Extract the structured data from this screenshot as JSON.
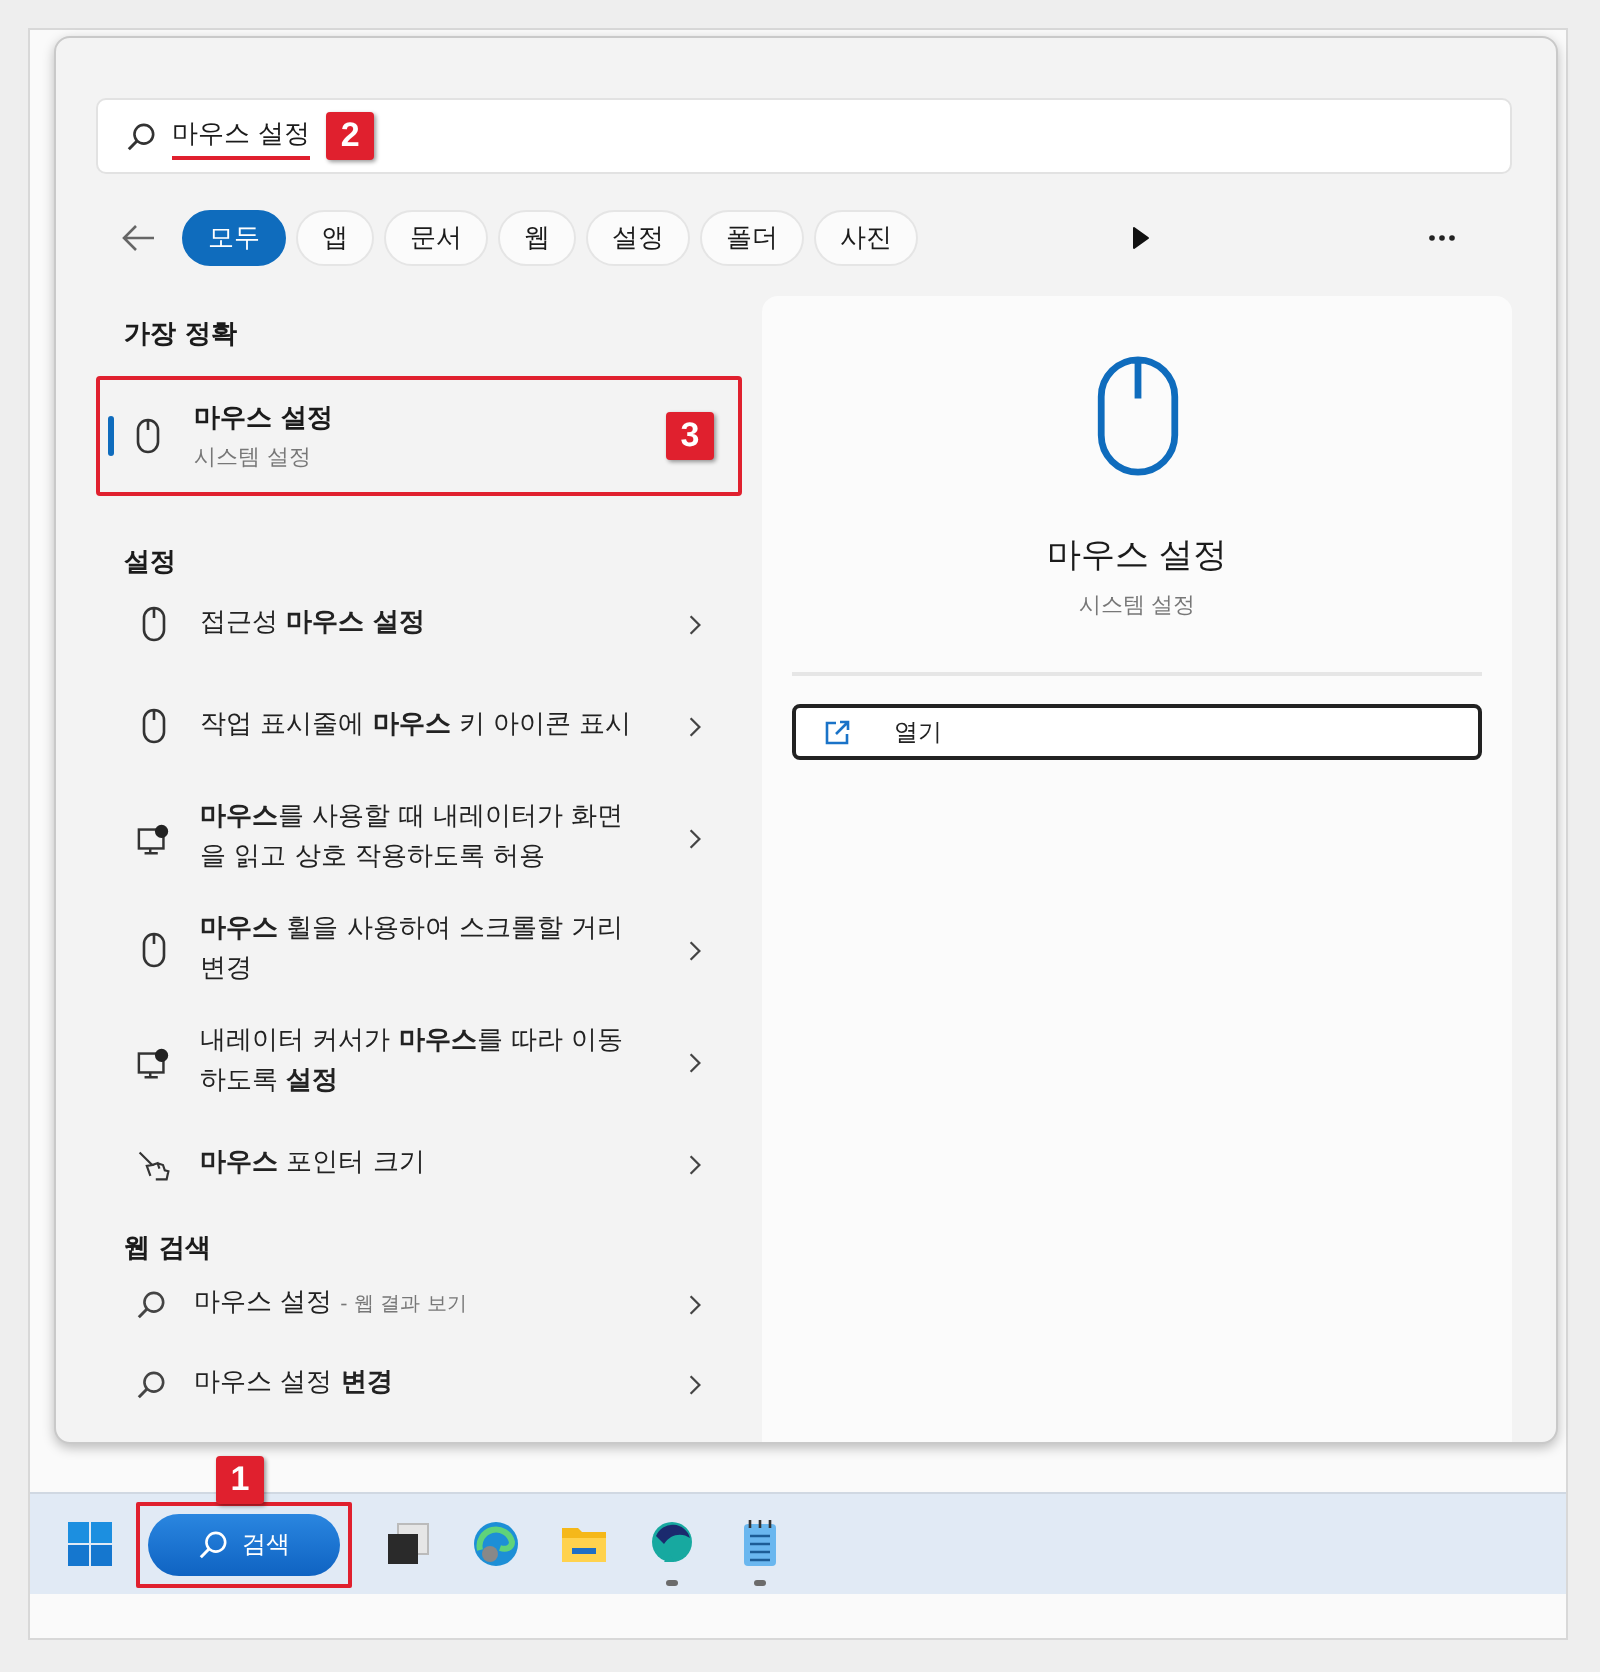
{
  "search": {
    "value": "마우스 설정",
    "callout": "2"
  },
  "filters": [
    {
      "label": "모두",
      "selected": true
    },
    {
      "label": "앱",
      "selected": false
    },
    {
      "label": "문서",
      "selected": false
    },
    {
      "label": "웹",
      "selected": false
    },
    {
      "label": "설정",
      "selected": false
    },
    {
      "label": "폴더",
      "selected": false
    },
    {
      "label": "사진",
      "selected": false
    }
  ],
  "best_match": {
    "heading": "가장 정확",
    "title": "마우스 설정",
    "subtitle": "시스템 설정",
    "selected": true,
    "callout": "3"
  },
  "settings": {
    "heading": "설정",
    "items": [
      {
        "kind": "mouse",
        "text": "접근성 **마우스 설정**"
      },
      {
        "kind": "mouse",
        "text": "작업 표시줄에 **마우스** 키 아이콘 표시"
      },
      {
        "kind": "narrator",
        "text": "**마우스**를 사용할 때 내레이터가 화면을 읽고 상호 작용하도록 허용"
      },
      {
        "kind": "mouse",
        "text": "**마우스** 휠을 사용하여 스크롤할 거리 변경"
      },
      {
        "kind": "narrator",
        "text": "내레이터 커서가 **마우스**를 따라 이동하도록 **설정**"
      },
      {
        "kind": "pointer",
        "text": "**마우스** 포인터 크기"
      }
    ]
  },
  "web": {
    "heading": "웹 검색",
    "items": [
      {
        "text": "마우스 설정",
        "hint": "- 웹 결과 보기"
      },
      {
        "text": "마우스 설정 **변경**"
      }
    ]
  },
  "detail": {
    "title": "마우스 설정",
    "subtitle": "시스템 설정",
    "actions": [
      {
        "label": "열기"
      }
    ]
  },
  "taskbar": {
    "search_label": "검색",
    "callout": "1",
    "apps": [
      {
        "kind": "taskview",
        "running": false
      },
      {
        "kind": "edge",
        "running": false
      },
      {
        "kind": "explorer",
        "running": false
      },
      {
        "kind": "whale",
        "running": true
      },
      {
        "kind": "notepad",
        "running": true
      }
    ]
  }
}
